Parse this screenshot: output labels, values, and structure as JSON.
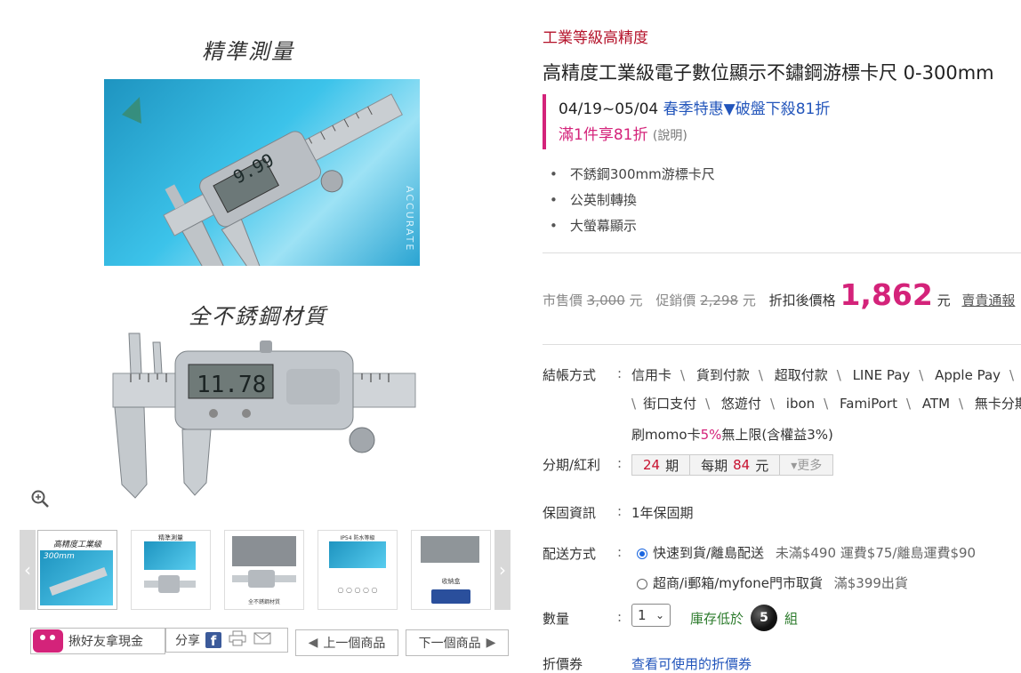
{
  "gallery": {
    "caption_top": "精準測量",
    "caption_mid": "全不銹鋼材質",
    "photo1_side_text": "ACCURATE",
    "display_reading_1": "9.99",
    "display_reading_2": "11.78",
    "zoom_icon": "zoom-in-icon",
    "thumbnails": [
      {
        "label": "高精度工業級",
        "sublabel": "300mm"
      },
      {
        "label": "精準測量"
      },
      {
        "label": "全不銹鋼材質"
      },
      {
        "label": "IP54 防水等級"
      },
      {
        "label": "收納盒"
      }
    ],
    "prev_arrow": "‹",
    "next_arrow": "›"
  },
  "share_bar": {
    "refer_label": "揪好友拿現金",
    "share_label": "分享",
    "facebook_letter": "f",
    "prev_product": "上一個商品",
    "next_product": "下一個商品"
  },
  "product": {
    "category": "工業等級高精度",
    "title": "高精度工業級電子數位顯示不鏽鋼游標卡尺 0-300mm",
    "promo_dates": "04/19~05/04",
    "promo_name": "春季特惠▼破盤下殺81折",
    "promo_rule": "滿1件享81折",
    "promo_explain": "(說明)",
    "features": [
      "不銹鋼300mm游標卡尺",
      "公英制轉換",
      "大螢幕顯示"
    ]
  },
  "price": {
    "market_label": "市售價",
    "market_value": "3,000",
    "promo_label": "促銷價",
    "promo_value": "2,298",
    "final_label": "折扣後價格",
    "final_value": "1,862",
    "currency": "元",
    "expensive_link": "賣貴通報"
  },
  "checkout": {
    "label": "結帳方式",
    "methods_row1": [
      "信用卡",
      "貨到付款",
      "超取付款",
      "LINE Pay",
      "Apple Pay"
    ],
    "methods_row2": [
      "街口支付",
      "悠遊付",
      "ibon",
      "FamiPort",
      "ATM",
      "無卡分期"
    ],
    "card_note_prefix": "刷momo卡",
    "card_note_rate": "5%",
    "card_note_suffix": "無上限(含權益3%)"
  },
  "installment": {
    "label": "分期/紅利",
    "periods": "24",
    "periods_unit": "期",
    "per_label": "每期",
    "per_value": "84",
    "per_unit": "元",
    "more": "▾更多"
  },
  "warranty": {
    "label": "保固資訊",
    "value": "1年保固期"
  },
  "delivery": {
    "label": "配送方式",
    "option1": "快速到貨/離島配送",
    "option1_note": "未滿$490 運費$75/離島運費$90",
    "option2": "超商/i郵箱/myfone門市取貨",
    "option2_note": "滿$399出貨"
  },
  "quantity": {
    "label": "數量",
    "selected": "1",
    "stock_prefix": "庫存低於",
    "stock_number": "5",
    "stock_suffix": "組"
  },
  "cut_row": {
    "label": "折價券",
    "value": "查看可使用的折價券"
  }
}
